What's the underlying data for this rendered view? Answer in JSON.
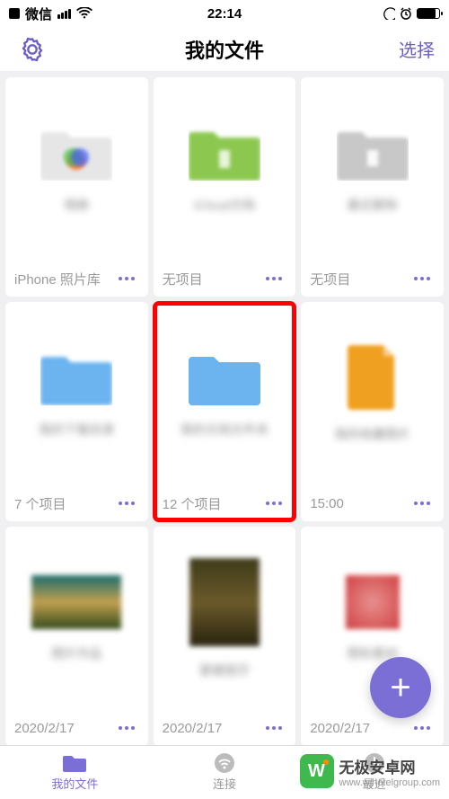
{
  "status": {
    "app": "微信",
    "time": "22:14"
  },
  "nav": {
    "title": "我的文件",
    "select": "选择"
  },
  "items": [
    {
      "name": "相册",
      "footer": "iPhone 照片库",
      "icon": "gallery"
    },
    {
      "name": "iCloud文档",
      "footer": "无项目",
      "icon": "folder-green"
    },
    {
      "name": "最近删除",
      "footer": "无项目",
      "icon": "folder-gray"
    },
    {
      "name": "我的下载目录",
      "footer": "7 个项目",
      "icon": "folder-blue"
    },
    {
      "name": "我的文档文件夹",
      "footer": "12 个项目",
      "icon": "folder-blue",
      "highlighted": true
    },
    {
      "name": "我的收藏图片",
      "footer": "15:00",
      "icon": "file-orange"
    },
    {
      "name": "图片作品",
      "footer": "2020/2/17",
      "thumb": "art1"
    },
    {
      "name": "蒙娜丽莎",
      "footer": "2020/2/17",
      "thumb": "mona"
    },
    {
      "name": "图标素材",
      "footer": "2020/2/17",
      "thumb": "red"
    }
  ],
  "tabs": {
    "files": "我的文件",
    "connect": "连接",
    "recent": "最近"
  },
  "watermark": {
    "text": "无极安卓网",
    "url": "www.wjhotelgroup.com"
  }
}
